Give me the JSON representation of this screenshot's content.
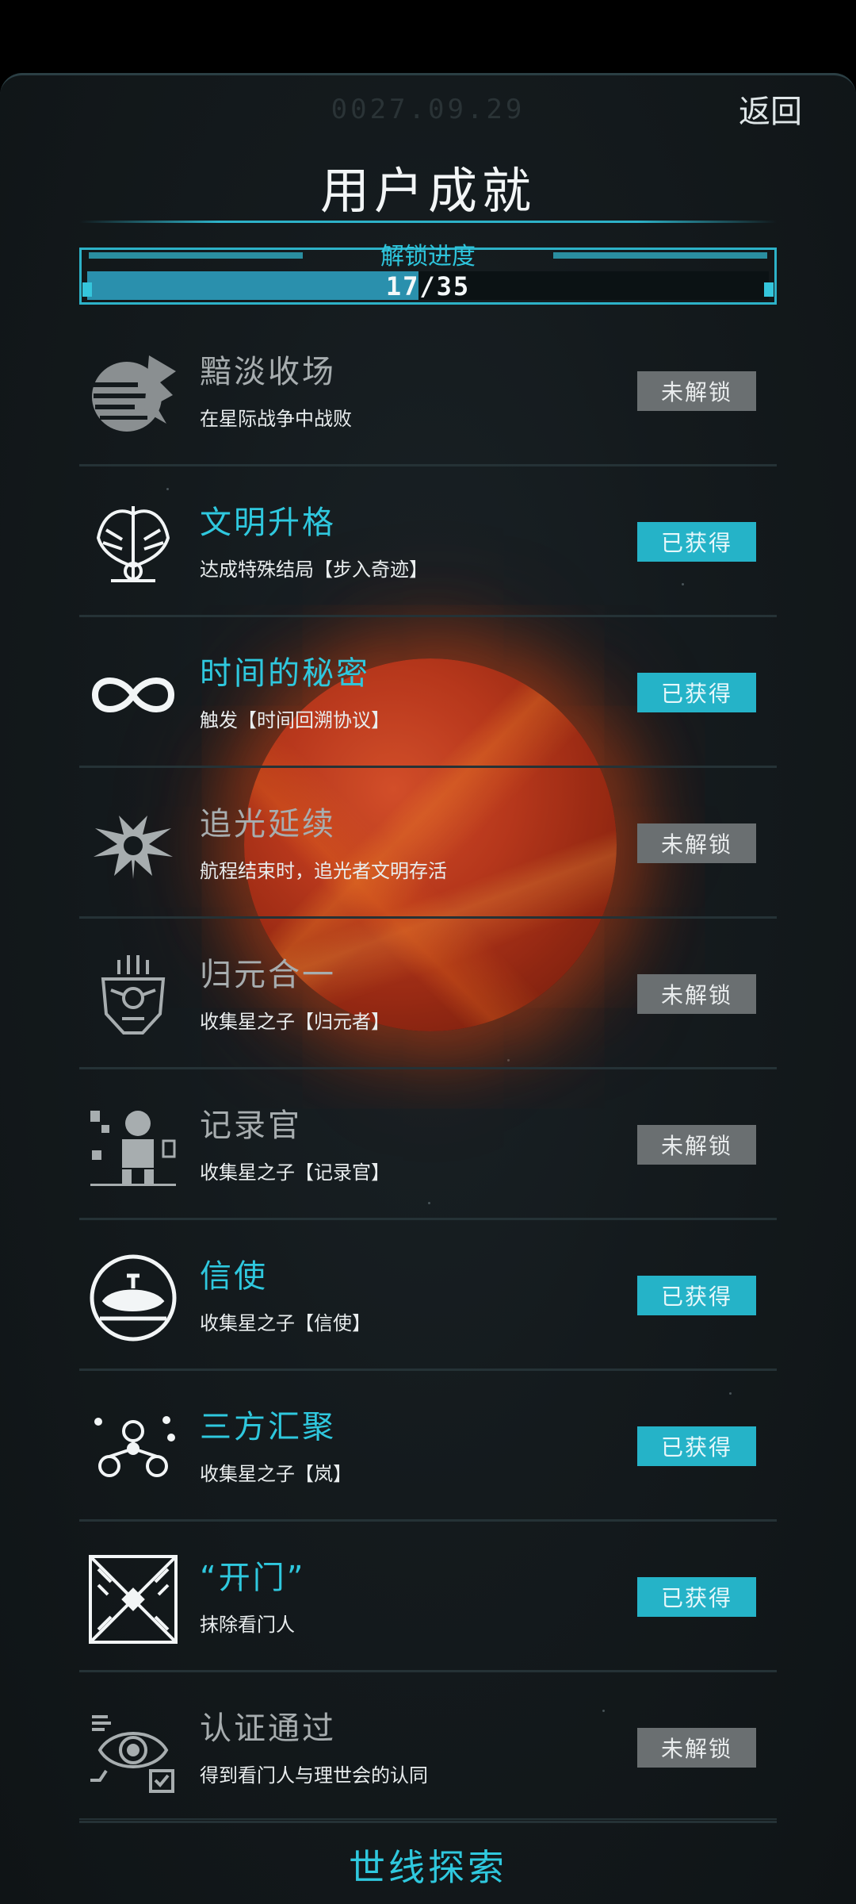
{
  "header": {
    "date": "0027.09.29",
    "back_label": "返回",
    "title": "用户成就"
  },
  "progress": {
    "label": "解锁进度",
    "text": "17/35",
    "unlocked": 17,
    "total": 35
  },
  "achievements": [
    {
      "name": "黯淡收场",
      "desc": "在星际战争中战败",
      "status": "未解锁",
      "state": "locked",
      "icon": "shattered-planet-icon"
    },
    {
      "name": "文明升格",
      "desc": "达成特殊结局【步入奇迹】",
      "status": "已获得",
      "state": "unlocked",
      "icon": "winged-emblem-icon"
    },
    {
      "name": "时间的秘密",
      "desc": "触发【时间回溯协议】",
      "status": "已获得",
      "state": "unlocked",
      "icon": "infinity-icon"
    },
    {
      "name": "追光延续",
      "desc": "航程结束时，追光者文明存活",
      "status": "未解锁",
      "state": "locked",
      "icon": "radiant-star-icon"
    },
    {
      "name": "归元合一",
      "desc": "收集星之子【归元者】",
      "status": "未解锁",
      "state": "locked",
      "icon": "mask-icon"
    },
    {
      "name": "记录官",
      "desc": "收集星之子【记录官】",
      "status": "未解锁",
      "state": "locked",
      "icon": "recorder-figure-icon"
    },
    {
      "name": "信使",
      "desc": "收集星之子【信使】",
      "status": "已获得",
      "state": "unlocked",
      "icon": "ship-in-circle-icon"
    },
    {
      "name": "三方汇聚",
      "desc": "收集星之子【岚】",
      "status": "已获得",
      "state": "unlocked",
      "icon": "three-people-icon"
    },
    {
      "name": "“开门”",
      "desc": "抹除看门人",
      "status": "已获得",
      "state": "unlocked",
      "icon": "gate-icon"
    },
    {
      "name": "认证通过",
      "desc": "得到看门人与理世会的认同",
      "status": "未解锁",
      "state": "locked",
      "icon": "eye-check-icon"
    }
  ],
  "footer": {
    "label": "世线探索"
  },
  "colors": {
    "accent": "#2fc8de",
    "locked_badge": "#6a6f71",
    "unlocked_badge": "#25b3c8",
    "background": "#141a1d"
  }
}
